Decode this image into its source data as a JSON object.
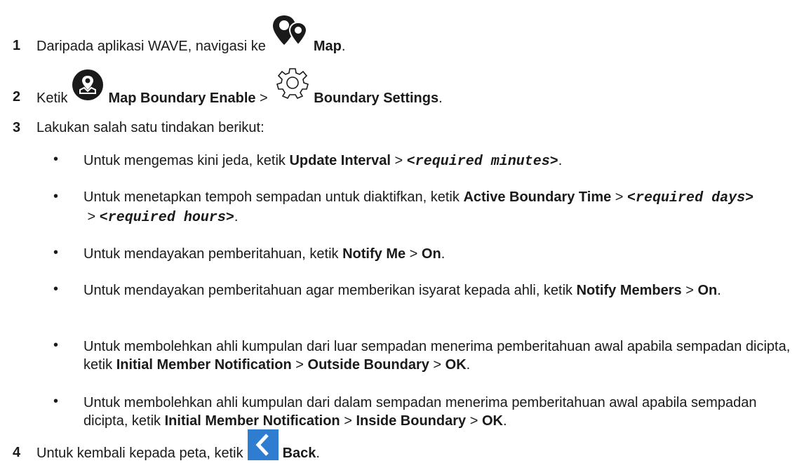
{
  "steps": [
    {
      "num": "1",
      "pre": "Daripada aplikasi WAVE, navigasi ke",
      "icon": "map-pins-icon",
      "label": "Map",
      "post": "."
    },
    {
      "num": "2",
      "pre": "Ketik",
      "icon": "map-boundary-icon",
      "label": "Map Boundary Enable",
      "sep": " > ",
      "icon2": "gear-icon",
      "label2": "Boundary Settings",
      "post": "."
    },
    {
      "num": "3",
      "text": "Lakukan salah satu tindakan berikut:"
    },
    {
      "num": "4",
      "pre": "Untuk kembali kepada peta, ketik",
      "icon": "back-icon",
      "label": "Back",
      "post": "."
    }
  ],
  "bullets": [
    {
      "a": "Untuk mengemas kini jeda, ketik ",
      "b1": "Update Interval",
      "s1": " > ",
      "m1": "<required minutes>",
      "end": "."
    },
    {
      "a": "Untuk menetapkan tempoh sempadan untuk diaktifkan, ketik ",
      "b1": "Active Boundary Time",
      "s1": " > ",
      "m1": "<required days>",
      "s2": " > ",
      "m2": "<required hours>",
      "end": "."
    },
    {
      "a": "Untuk mendayakan pemberitahuan, ketik ",
      "b1": "Notify Me",
      "s1": " > ",
      "b2": "On",
      "end": "."
    },
    {
      "a": "Untuk mendayakan pemberitahuan agar memberikan isyarat kepada ahli, ketik ",
      "b1": "Notify Members",
      "s1": " > ",
      "b2": "On",
      "end": "."
    },
    {
      "a": "Untuk membolehkan ahli kumpulan dari luar sempadan menerima pemberitahuan awal apabila sempadan dicipta, ketik ",
      "b1": "Initial Member Notification",
      "s1": " > ",
      "b2": "Outside Boundary",
      "s2": " > ",
      "b3": "OK",
      "end": "."
    },
    {
      "a": "Untuk membolehkan ahli kumpulan dari dalam sempadan menerima pemberitahuan awal apabila sempadan dicipta, ketik ",
      "b1": "Initial Member Notification",
      "s1": " > ",
      "b2": "Inside Boundary",
      "s2": " > ",
      "b3": "OK",
      "end": "."
    }
  ],
  "bullet_char": "•",
  "colors": {
    "back_icon": "#2f7dd1",
    "text": "#1a1a1a"
  }
}
